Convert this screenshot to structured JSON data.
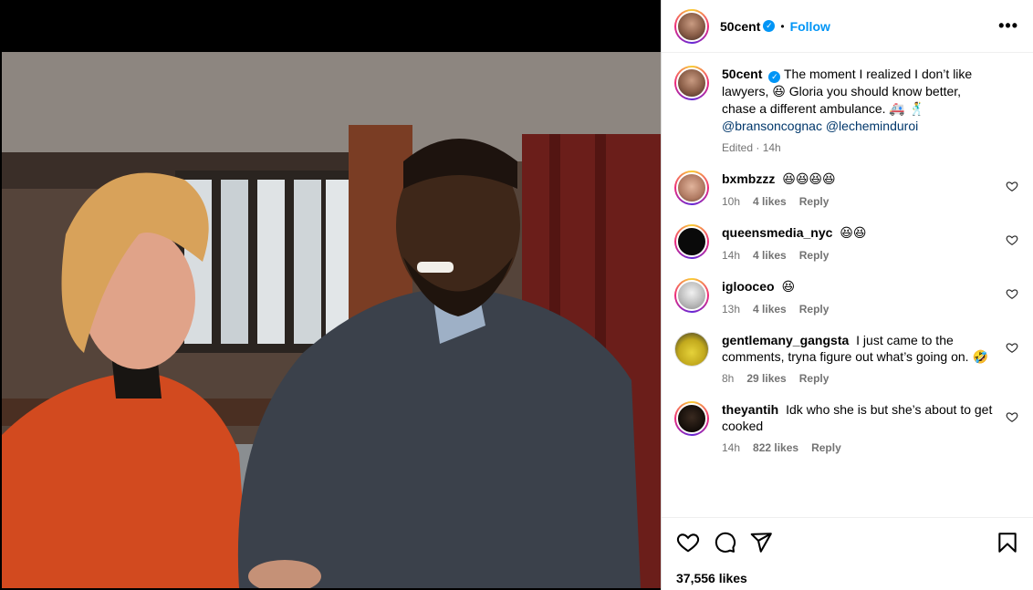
{
  "post": {
    "author": "50cent",
    "follow_label": "Follow",
    "dot": "•",
    "more": "•••",
    "caption_start": "The moment I realized I don’t like lawyers, ",
    "caption_emoji1": "😆",
    "caption_mid": " Gloria you should know better, chase a different ambulance. ",
    "caption_emoji2": "🚑 🕺",
    "mention1": "@bransoncognac",
    "mention2": "@lecheminduroi",
    "edited": "Edited · 14h",
    "likes": "37,556 likes"
  },
  "comments": [
    {
      "user": "bxmbzzz",
      "text": "😆😆😆😆",
      "time": "10h",
      "likes": "4 likes",
      "reply": "Reply"
    },
    {
      "user": "queensmedia_nyc",
      "text": "😆😆",
      "time": "14h",
      "likes": "4 likes",
      "reply": "Reply"
    },
    {
      "user": "iglooceo",
      "text": "😆",
      "time": "13h",
      "likes": "4 likes",
      "reply": "Reply"
    },
    {
      "user": "gentlemany_gangsta",
      "text": "I just came to the comments, tryna figure out what’s going on. 🤣",
      "time": "8h",
      "likes": "29 likes",
      "reply": "Reply"
    },
    {
      "user": "theyantih",
      "text": "Idk who she is but she’s about to get cooked",
      "time": "14h",
      "likes": "822 likes",
      "reply": "Reply"
    }
  ],
  "icons": {
    "like": "heart-icon",
    "comment": "comment-icon",
    "share": "share-icon",
    "save": "bookmark-icon",
    "verified": "verified-badge-icon"
  },
  "colors": {
    "accent": "#0095f6",
    "mention": "#00376b",
    "muted": "#737373"
  }
}
